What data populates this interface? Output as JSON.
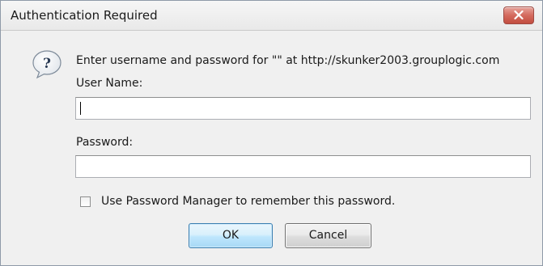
{
  "window": {
    "title": "Authentication Required",
    "close_icon": "close-icon"
  },
  "dialog": {
    "icon": "question-icon",
    "prompt": "Enter username and password for \"\" at http://skunker2003.grouplogic.com",
    "username_label": "User Name:",
    "username_value": "",
    "password_label": "Password:",
    "password_value": "",
    "remember_label": "Use Password Manager to remember this password.",
    "remember_checked": false
  },
  "buttons": {
    "ok_label": "OK",
    "cancel_label": "Cancel"
  },
  "colors": {
    "close_button": "#d46a5e",
    "ok_button_border": "#3c7fb1",
    "dialog_background": "#f0f0f0"
  }
}
